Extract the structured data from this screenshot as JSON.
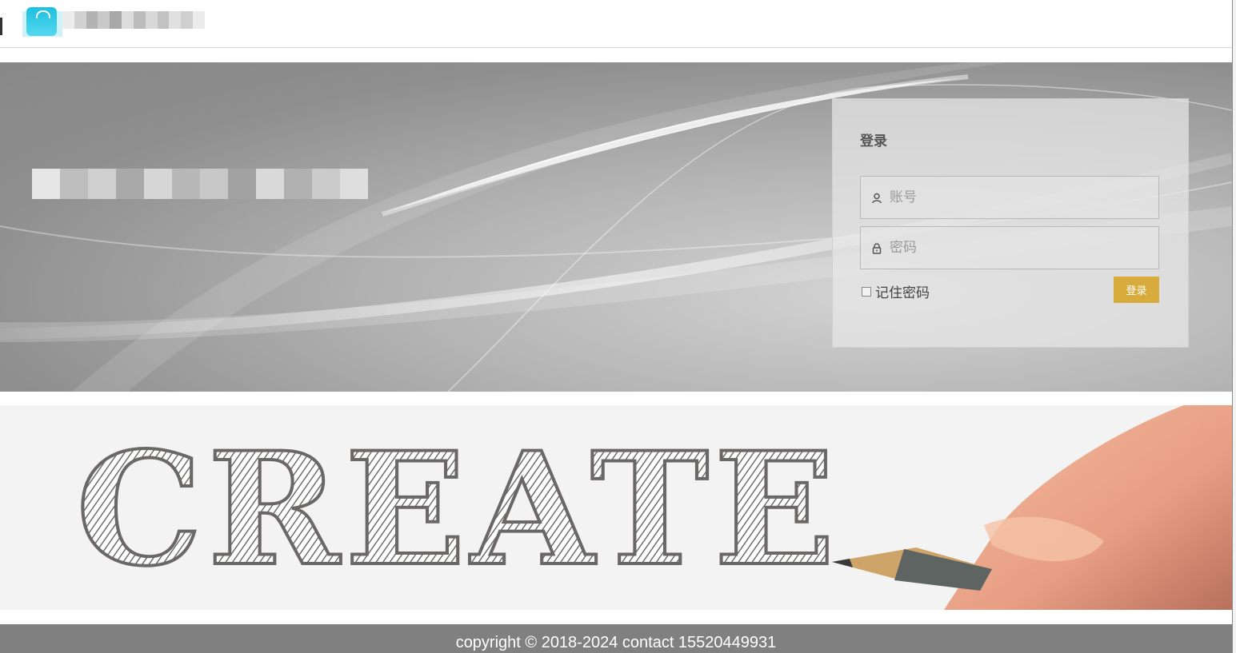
{
  "header": {
    "logo": "shield-logo-icon",
    "brand_text": ""
  },
  "banner": {
    "title": "",
    "subtitle": ""
  },
  "login": {
    "title": "登录",
    "username_placeholder": "账号",
    "password_placeholder": "密码",
    "remember_label": "记住密码",
    "submit_label": "登录",
    "remember_checked": false
  },
  "illustration": {
    "word": "CREATE"
  },
  "footer": {
    "copyright": "copyright © 2018-2024 contact 15520449931"
  },
  "colors": {
    "accent_button": "#d7ab3c",
    "footer_bg": "#808080",
    "logo": "#1bbfe0"
  }
}
